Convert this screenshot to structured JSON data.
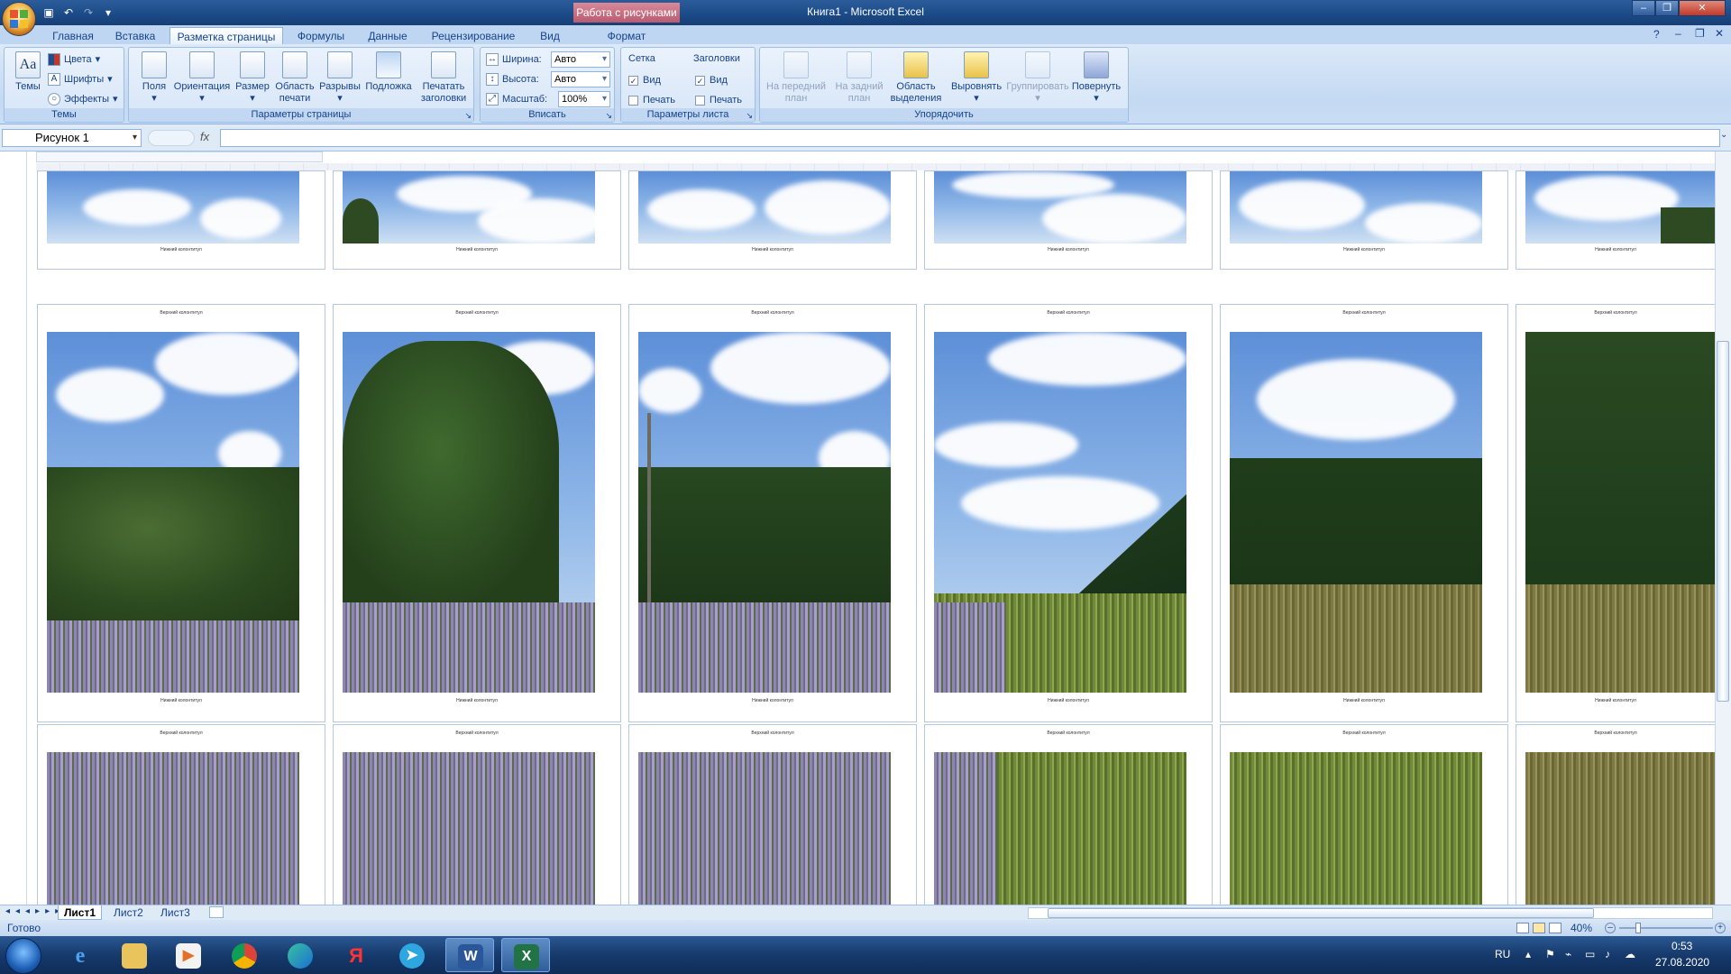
{
  "window": {
    "title": "Книга1 - Microsoft Excel",
    "contextual_tab": "Работа с рисунками"
  },
  "ribbon_tabs": [
    {
      "label": "Главная"
    },
    {
      "label": "Вставка"
    },
    {
      "label": "Разметка страницы"
    },
    {
      "label": "Формулы"
    },
    {
      "label": "Данные"
    },
    {
      "label": "Рецензирование"
    },
    {
      "label": "Вид"
    },
    {
      "label": "Формат"
    }
  ],
  "active_tab": "Разметка страницы",
  "ribbon": {
    "themes": {
      "label": "Темы",
      "themes_button": "Темы",
      "colors": "Цвета",
      "fonts": "Шрифты",
      "effects": "Эффекты"
    },
    "page_setup": {
      "label": "Параметры страницы",
      "margins": "Поля",
      "orientation": "Ориентация",
      "size": "Размер",
      "print_area_1": "Область",
      "print_area_2": "печати",
      "breaks": "Разрывы",
      "background": "Подложка",
      "print_titles_1": "Печатать",
      "print_titles_2": "заголовки"
    },
    "scale_to_fit": {
      "label": "Вписать",
      "width_label": "Ширина:",
      "width_value": "Авто",
      "height_label": "Высота:",
      "height_value": "Авто",
      "scale_label": "Масштаб:",
      "scale_value": "100%"
    },
    "sheet_options": {
      "label": "Параметры листа",
      "gridlines": "Сетка",
      "headings": "Заголовки",
      "view": "Вид",
      "print": "Печать",
      "gridlines_view_checked": true,
      "gridlines_print_checked": false,
      "headings_view_checked": true,
      "headings_print_checked": false
    },
    "arrange": {
      "label": "Упорядочить",
      "bring_front_1": "На передний",
      "bring_front_2": "план",
      "send_back_1": "На задний",
      "send_back_2": "план",
      "selection_pane_1": "Область",
      "selection_pane_2": "выделения",
      "align": "Выровнять",
      "group": "Группировать",
      "rotate": "Повернуть"
    }
  },
  "formula_bar": {
    "name_box": "Рисунок 1",
    "fx": "fx",
    "formula": ""
  },
  "pages": {
    "header_text": "Верхний колонтитул",
    "footer_text": "Нижний колонтитул"
  },
  "sheet_tabs": [
    {
      "label": "Лист1"
    },
    {
      "label": "Лист2"
    },
    {
      "label": "Лист3"
    }
  ],
  "status": {
    "ready": "Готово",
    "zoom": "40%"
  },
  "taskbar": {
    "lang": "RU",
    "time": "0:53",
    "date": "27.08.2020"
  },
  "colors": {
    "ribbon_bg": "#c4d9f2",
    "title_bg": "#1b4a86",
    "contextual": "#b85b70",
    "taskbar_bg": "#163a6c"
  }
}
